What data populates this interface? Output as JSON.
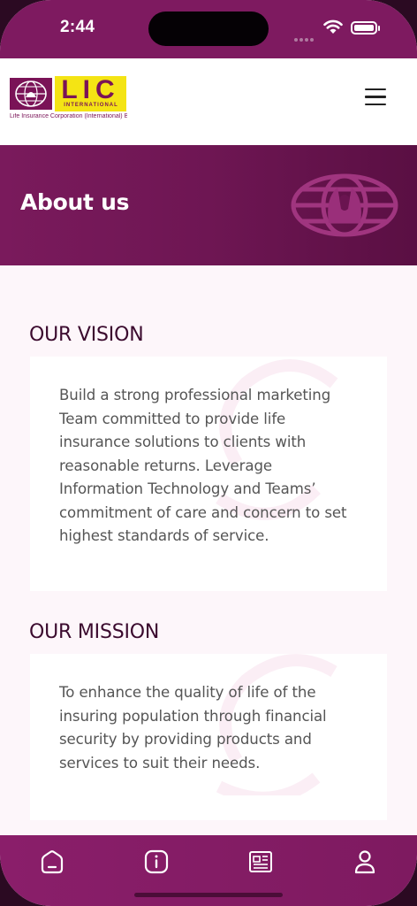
{
  "status_bar": {
    "time": "2:44"
  },
  "header": {
    "logo": {
      "letters": "LIC",
      "subline": "INTERNATIONAL",
      "caption": "Life Insurance Corporation (International) B.S.C.(c)"
    },
    "menu_icon": "hamburger-menu-icon"
  },
  "banner": {
    "title": "About us",
    "emblem_icon": "globe-hands-emblem"
  },
  "sections": [
    {
      "title": "OUR VISION",
      "body": "Build a strong professional marketing Team committed to provide life insurance solutions to clients with reasonable returns. Leverage Information Technology and Teams’ commitment of care and concern to set highest standards of service."
    },
    {
      "title": "OUR MISSION",
      "body": "To enhance the quality of life of the insuring population through financial security by providing products and services to suit their needs."
    }
  ],
  "tab_bar": {
    "tabs": [
      {
        "icon": "home-icon"
      },
      {
        "icon": "info-icon"
      },
      {
        "icon": "news-icon"
      },
      {
        "icon": "profile-icon"
      }
    ]
  },
  "colors": {
    "brand_purple": "#7e1a60",
    "brand_yellow": "#f4e414",
    "background": "#fdf6fa",
    "heading": "#3b0a2e",
    "body_text": "#555555"
  }
}
